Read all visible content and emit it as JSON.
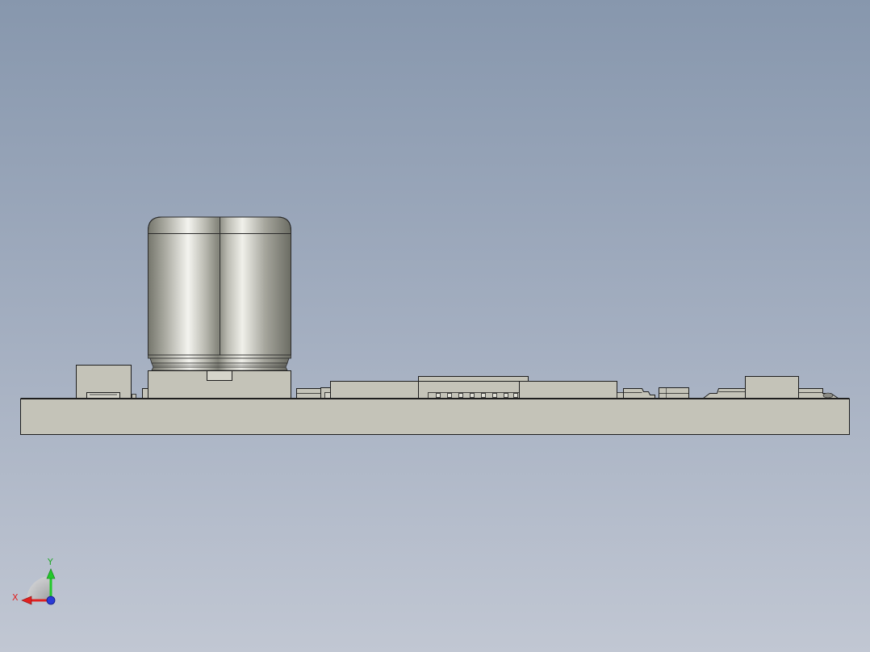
{
  "viewport": {
    "background_top": "#8797ad",
    "background_bottom": "#c1c7d3"
  },
  "model": {
    "body_color": "#c4c3b8",
    "edge_color": "#1e1e1e",
    "metal_light": "#f4f4ef",
    "metal_dark": "#75766c"
  },
  "triad": {
    "x_label": "X",
    "y_label": "Y",
    "x_color": "#e02020",
    "y_color": "#22c82a",
    "z_color": "#2a3ad6"
  }
}
